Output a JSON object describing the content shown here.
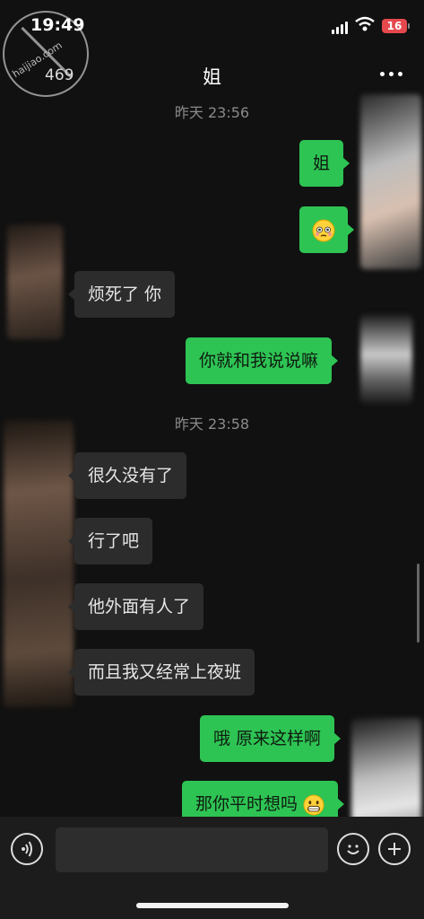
{
  "status_bar": {
    "time": "19:49",
    "battery": "16"
  },
  "watermark": {
    "text": "haijiao.com"
  },
  "nav": {
    "back_count": "469",
    "title": "姐",
    "more_label": "···"
  },
  "timestamps": [
    "昨天 23:56",
    "昨天 23:58"
  ],
  "messages": [
    {
      "side": "out",
      "text": "姐"
    },
    {
      "side": "out",
      "text": "",
      "emoji": "flushed-face"
    },
    {
      "side": "in",
      "text": "烦死了 你"
    },
    {
      "side": "out",
      "text": "你就和我说说嘛"
    },
    {
      "side": "in",
      "text": "很久没有了"
    },
    {
      "side": "in",
      "text": "行了吧"
    },
    {
      "side": "in",
      "text": "他外面有人了"
    },
    {
      "side": "in",
      "text": "而且我又经常上夜班"
    },
    {
      "side": "out",
      "text": "哦 原来这样啊"
    },
    {
      "side": "out",
      "text": "那你平时想吗",
      "emoji": "grinning-face"
    }
  ],
  "input_bar": {
    "placeholder": ""
  },
  "colors": {
    "outgoing": "#2ec454",
    "incoming": "#2c2c2c",
    "background": "#111111"
  }
}
